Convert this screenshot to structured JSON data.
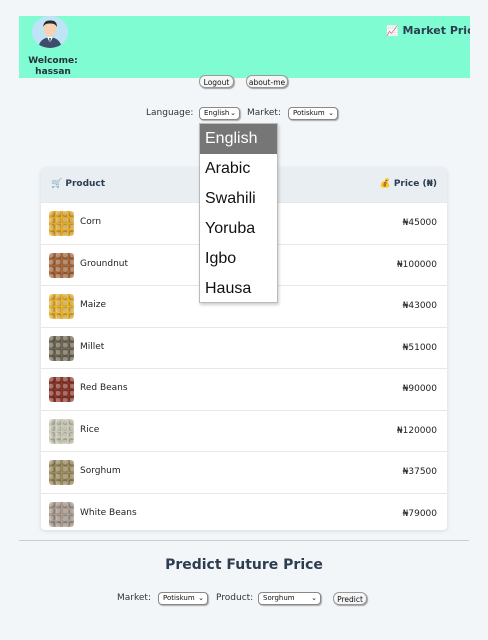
{
  "header": {
    "welcome": "Welcome:",
    "username": "hassan",
    "title_icon": "📈",
    "title": "Market Price"
  },
  "buttons": {
    "logout": "Logout",
    "about": "about-me"
  },
  "filters": {
    "language_label": "Language:",
    "language_value": "English",
    "market_label": "Market:",
    "market_value": "Potiskum"
  },
  "language_options": [
    "English",
    "Arabic",
    "Swahili",
    "Yoruba",
    "Igbo",
    "Hausa"
  ],
  "table": {
    "product_icon": "🛒",
    "product_header": "Product",
    "price_icon": "💰",
    "price_header": "Price (₦)",
    "rows": [
      {
        "name": "Corn",
        "price": "₦45000",
        "color": "#e3a92a"
      },
      {
        "name": "Groundnut",
        "price": "₦100000",
        "color": "#a8663a"
      },
      {
        "name": "Maize",
        "price": "₦43000",
        "color": "#e6b12e"
      },
      {
        "name": "Millet",
        "price": "₦51000",
        "color": "#6e6552"
      },
      {
        "name": "Red Beans",
        "price": "₦90000",
        "color": "#8a3328"
      },
      {
        "name": "Rice",
        "price": "₦120000",
        "color": "#c9c8b4"
      },
      {
        "name": "Sorghum",
        "price": "₦37500",
        "color": "#9a8a5c"
      },
      {
        "name": "White Beans",
        "price": "₦79000",
        "color": "#a89a8e"
      }
    ]
  },
  "predict": {
    "title": "Predict Future Price",
    "market_label": "Market:",
    "market_value": "Potiskum",
    "product_label": "Product:",
    "product_value": "Sorghum",
    "button": "Predict"
  }
}
